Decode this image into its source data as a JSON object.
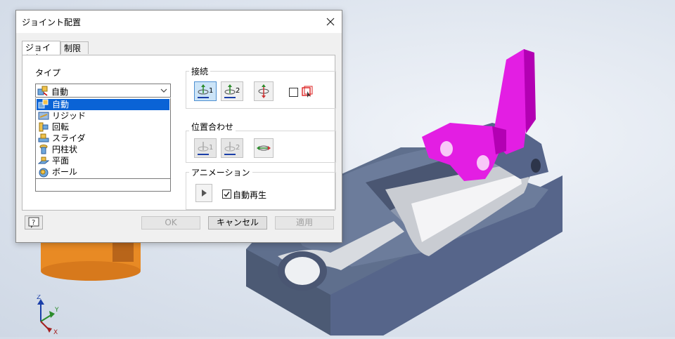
{
  "dialog": {
    "title": "ジョイント配置",
    "tabs": [
      {
        "label": "ジョイント"
      },
      {
        "label": "制限"
      }
    ],
    "type_section": {
      "label": "タイプ",
      "selected_value": "自動",
      "options": [
        {
          "label": "自動",
          "icon": "auto-joint-icon"
        },
        {
          "label": "リジッド",
          "icon": "rigid-joint-icon"
        },
        {
          "label": "回転",
          "icon": "rotational-joint-icon"
        },
        {
          "label": "スライダ",
          "icon": "slider-joint-icon"
        },
        {
          "label": "円柱状",
          "icon": "cylindrical-joint-icon"
        },
        {
          "label": "平面",
          "icon": "planar-joint-icon"
        },
        {
          "label": "ボール",
          "icon": "ball-joint-icon"
        }
      ]
    },
    "connect_section": {
      "label": "接続",
      "button1_num": "1",
      "button2_num": "2"
    },
    "align_section": {
      "label": "位置合わせ",
      "button1_num": "1",
      "button2_num": "2"
    },
    "animation_section": {
      "label": "アニメーション",
      "autoplay_label": "自動再生",
      "autoplay_checked": true
    },
    "buttons": {
      "ok": "OK",
      "cancel": "キャンセル",
      "apply": "適用"
    }
  },
  "triad": {
    "x_label": "X",
    "y_label": "Y",
    "z_label": "Z"
  },
  "colors": {
    "selection": "#0a63d6",
    "model_grey": "#5f6f8d",
    "model_magenta": "#e31ee3",
    "model_orange": "#e88a24",
    "viewport_bg": "#dde4ee"
  }
}
